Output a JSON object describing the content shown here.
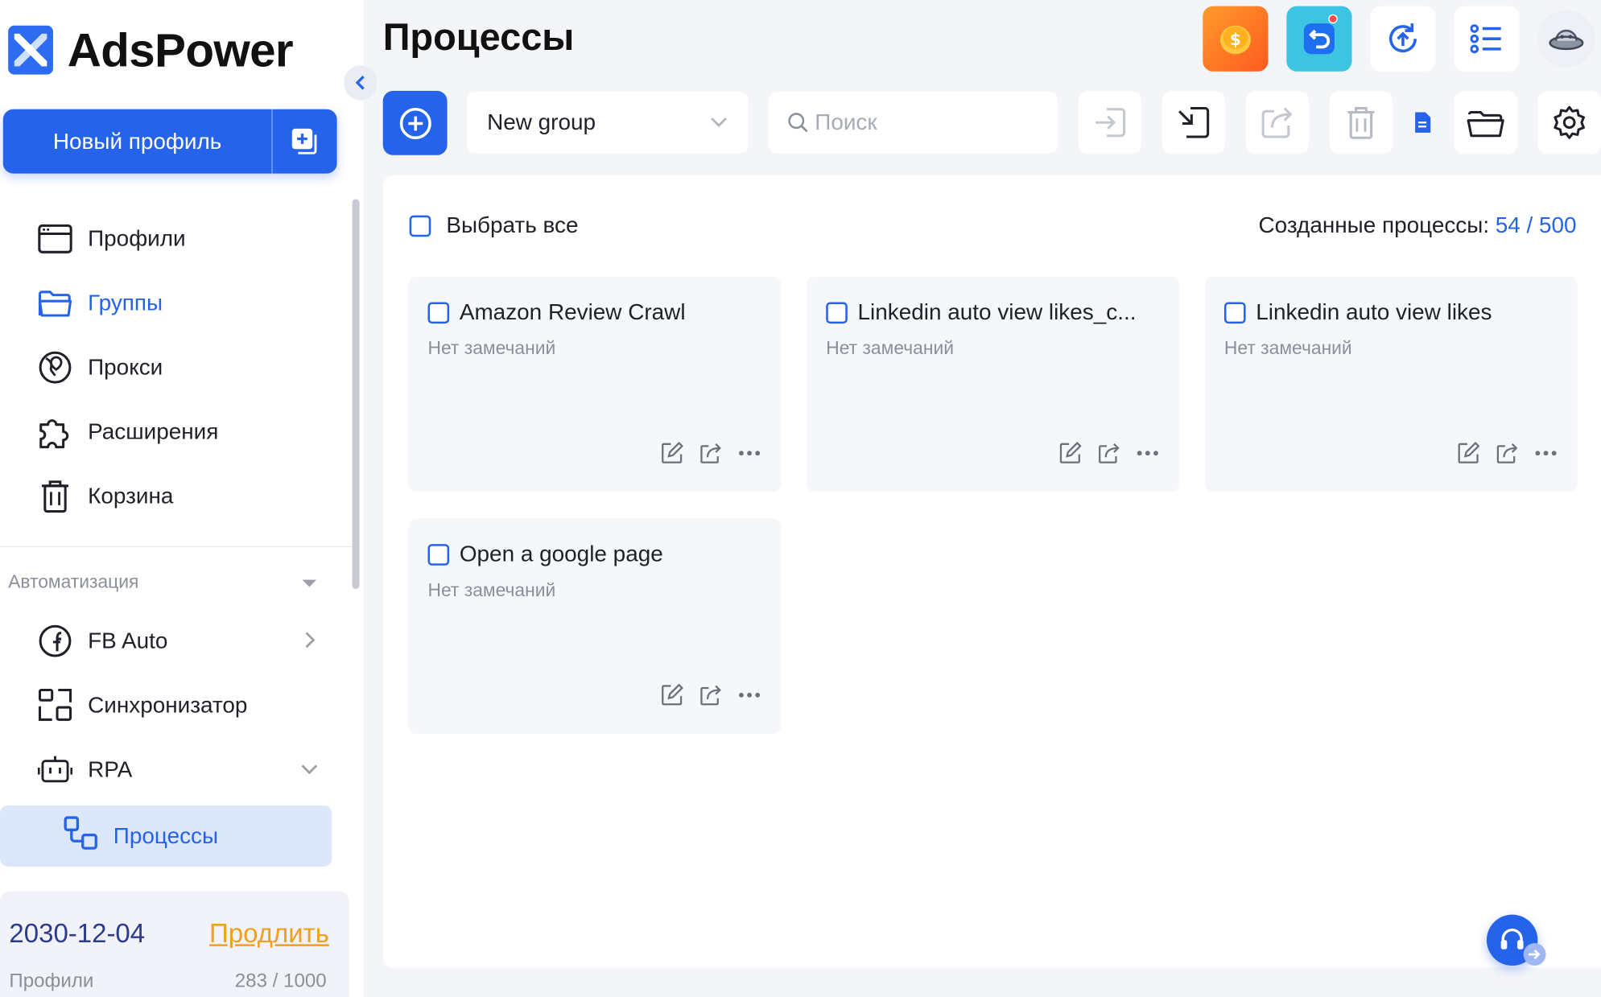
{
  "app": {
    "brand": "AdsPower"
  },
  "sidebar": {
    "new_profile_label": "Новый профиль",
    "items": [
      {
        "label": "Профили",
        "icon": "browser-window-icon"
      },
      {
        "label": "Группы",
        "icon": "folder-icon",
        "active": true
      },
      {
        "label": "Прокси",
        "icon": "globe-pin-icon"
      },
      {
        "label": "Расширения",
        "icon": "puzzle-icon"
      },
      {
        "label": "Корзина",
        "icon": "trash-icon"
      }
    ],
    "automation_title": "Автоматизация",
    "automation_items": [
      {
        "label": "FB Auto",
        "icon": "facebook-icon"
      },
      {
        "label": "Синхронизатор",
        "icon": "sync-screens-icon"
      },
      {
        "label": "RPA",
        "icon": "robot-icon"
      }
    ],
    "processes_label": "Процессы",
    "license": {
      "expiry": "2030-12-04",
      "renew_label": "Продлить",
      "profiles_label": "Профили",
      "profiles_count": "283 / 1000"
    }
  },
  "header": {
    "title": "Процессы"
  },
  "toolbar": {
    "group_value": "New group",
    "search_placeholder": "Поиск"
  },
  "main": {
    "select_all_label": "Выбрать все",
    "created_label": "Созданные процессы:",
    "created_count": "54 / 500",
    "cards": [
      {
        "title": "Amazon Review Crawl",
        "note": "Нет замечаний"
      },
      {
        "title": "Linkedin auto view likes_c...",
        "note": "Нет замечаний"
      },
      {
        "title": "Linkedin auto view likes",
        "note": "Нет замечаний"
      },
      {
        "title": "Open a google page",
        "note": "Нет замечаний"
      }
    ]
  },
  "colors": {
    "accent": "#2563eb",
    "renew": "#f0a020",
    "active_bg": "#dde7fb"
  }
}
